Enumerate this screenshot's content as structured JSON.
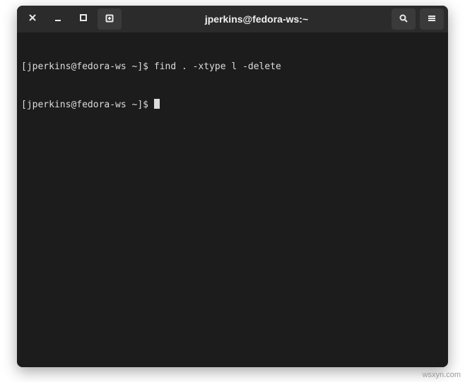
{
  "window": {
    "title": "jperkins@fedora-ws:~"
  },
  "terminal": {
    "lines": [
      {
        "prompt": "[jperkins@fedora-ws ~]$ ",
        "command": "find . -xtype l -delete"
      },
      {
        "prompt": "[jperkins@fedora-ws ~]$ ",
        "command": ""
      }
    ]
  },
  "icons": {
    "close": "close-icon",
    "minimize": "minimize-icon",
    "maximize": "maximize-icon",
    "new_tab": "new-tab-icon",
    "search": "search-icon",
    "menu": "hamburger-icon"
  },
  "watermark": "wsxyn.com"
}
